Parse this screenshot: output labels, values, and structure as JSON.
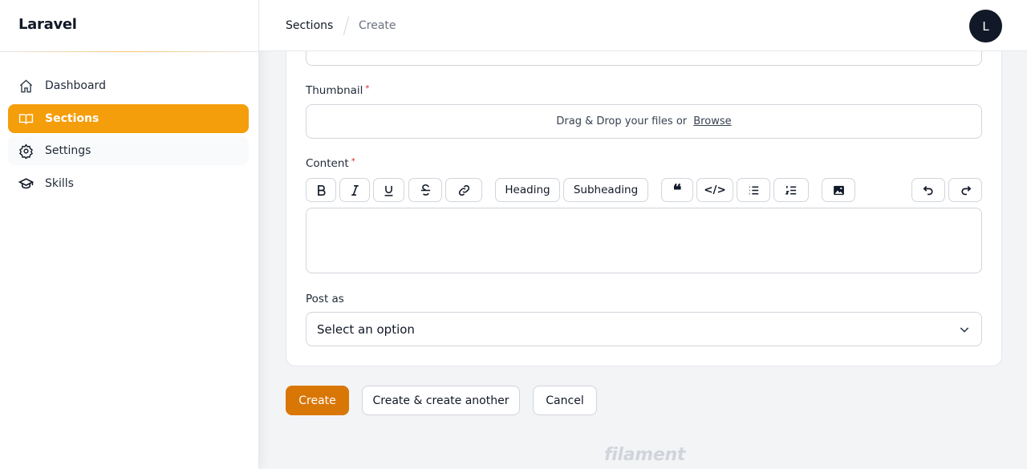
{
  "brand": "Laravel",
  "sidebar": {
    "items": [
      {
        "label": "Dashboard",
        "icon": "home-icon"
      },
      {
        "label": "Sections",
        "icon": "book-open-icon",
        "active": true
      },
      {
        "label": "Settings",
        "icon": "gear-icon"
      },
      {
        "label": "Skills",
        "icon": "academic-cap-icon"
      }
    ]
  },
  "breadcrumb": [
    "Sections",
    "Create"
  ],
  "user": {
    "avatar_initial": "L"
  },
  "form": {
    "thumbnail": {
      "label": "Thumbnail",
      "required": "*",
      "dropzone_text": "Drag & Drop your files or ",
      "browse": "Browse"
    },
    "content": {
      "label": "Content",
      "required": "*",
      "toolbar": {
        "heading": "Heading",
        "subheading": "Subheading"
      }
    },
    "post_as": {
      "label": "Post as",
      "placeholder": "Select an option"
    }
  },
  "actions": {
    "create": "Create",
    "create_another": "Create & create another",
    "cancel": "Cancel"
  },
  "footer": {
    "logo": "filament"
  },
  "colors": {
    "primary": "#f59e0b",
    "create_button": "#d97706"
  }
}
